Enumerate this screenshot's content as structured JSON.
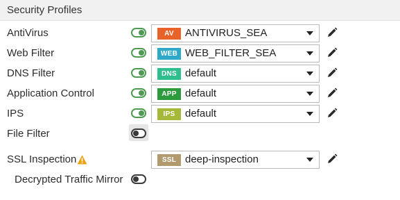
{
  "section": {
    "title": "Security Profiles"
  },
  "rows": [
    {
      "label": "AntiVirus",
      "toggle": "on",
      "badge": "AV",
      "badge_color": "#e8622a",
      "value": "ANTIVIRUS_SEA"
    },
    {
      "label": "Web Filter",
      "toggle": "on",
      "badge": "WEB",
      "badge_color": "#2fa9c7",
      "value": "WEB_FILTER_SEA"
    },
    {
      "label": "DNS Filter",
      "toggle": "on",
      "badge": "DNS",
      "badge_color": "#2fbf8f",
      "value": "default"
    },
    {
      "label": "Application Control",
      "toggle": "on",
      "badge": "APP",
      "badge_color": "#2d9b3d",
      "value": "default"
    },
    {
      "label": "IPS",
      "toggle": "on",
      "badge": "IPS",
      "badge_color": "#a6b83a",
      "value": "default"
    },
    {
      "label": "File Filter",
      "toggle": "off"
    }
  ],
  "ssl": {
    "label": "SSL Inspection",
    "badge": "SSL",
    "badge_color": "#b09a6e",
    "value": "deep-inspection",
    "warning_icon": "warning-triangle-icon",
    "warning_color": "#e8a317"
  },
  "mirror": {
    "label": "Decrypted Traffic Mirror",
    "toggle": "off"
  },
  "colors": {
    "toggle_on": "#4e9a52",
    "toggle_off": "#3a3a3a"
  }
}
